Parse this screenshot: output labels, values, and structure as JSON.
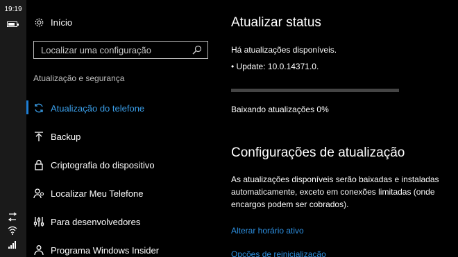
{
  "status_bar": {
    "time": "19:19"
  },
  "nav": {
    "home_label": "Início",
    "search_placeholder": "Localizar uma configuração",
    "section_label": "Atualização e segurança",
    "items": [
      {
        "label": "Atualização do telefone",
        "icon": "sync-icon",
        "active": true
      },
      {
        "label": "Backup",
        "icon": "backup-icon",
        "active": false
      },
      {
        "label": "Criptografia do dispositivo",
        "icon": "lock-icon",
        "active": false
      },
      {
        "label": "Localizar Meu Telefone",
        "icon": "person-location-icon",
        "active": false
      },
      {
        "label": "Para desenvolvedores",
        "icon": "developer-icon",
        "active": false
      },
      {
        "label": "Programa Windows Insider",
        "icon": "insider-icon",
        "active": false
      }
    ]
  },
  "update_status": {
    "title": "Atualizar status",
    "available_text": "Há atualizações disponíveis.",
    "update_item": "• Update: 10.0.14371.0.",
    "progress_fraction": 0.0,
    "downloading_text": "Baixando atualizações 0%"
  },
  "update_settings": {
    "title": "Configurações de atualização",
    "description": "As atualizações disponíveis serão baixadas e instaladas automaticamente, exceto em conexões limitadas (onde encargos podem ser cobrados).",
    "link_active_hours": "Alterar horário ativo",
    "link_restart_options": "Opções de reinicialização"
  },
  "colors": {
    "accent": "#1e7fd6",
    "link": "#2d8fe0",
    "background": "#000000",
    "statusbar_bg": "#1a1a1a"
  }
}
